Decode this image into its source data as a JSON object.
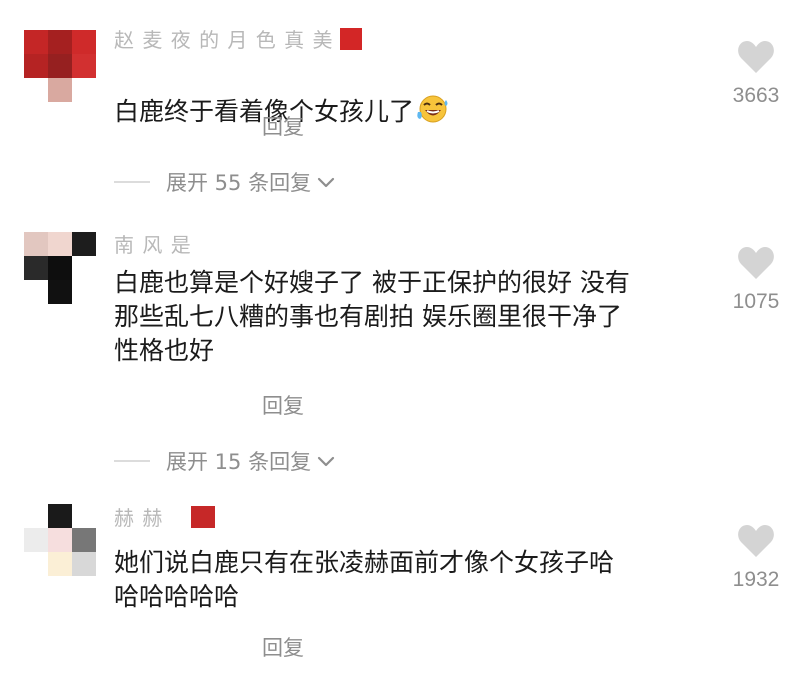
{
  "comments": [
    {
      "username": "赵 麦 夜 的 月 色 真 美",
      "text": "白鹿终于看着像个女孩儿了",
      "emoji": "grinning-face-with-sweat-icon",
      "reply_label": "回复",
      "expand_label": "展开 55 条回复",
      "likes": "3663"
    },
    {
      "username": "南 风 是",
      "text": "白鹿也算是个好嫂子了 被于正保护的很好 没有\n那些乱七八糟的事也有剧拍 娱乐圈里很干净了\n性格也好",
      "reply_label": "回复",
      "expand_label": "展开 15 条回复",
      "likes": "1075"
    },
    {
      "username": "赫 赫",
      "text": "她们说白鹿只有在张凌赫面前才像个女孩子哈\n哈哈哈哈哈",
      "reply_label": "回复",
      "likes": "1932"
    }
  ],
  "icons": {
    "like": "heart-icon",
    "expand": "chevron-down-icon"
  },
  "colors": {
    "text": "#1b1b1b",
    "muted": "#8e8e8e",
    "heart": "#d4d4d4",
    "mosaic_red": "#c62828"
  }
}
